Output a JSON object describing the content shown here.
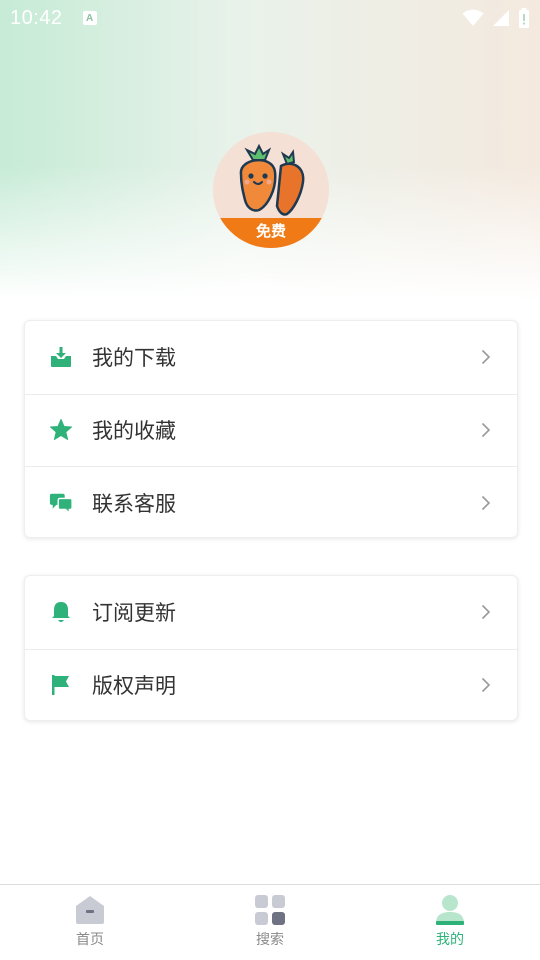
{
  "status_bar": {
    "time": "10:42",
    "notification_icon": "a-icon",
    "icons": [
      "wifi-icon",
      "signal-icon",
      "battery-icon"
    ]
  },
  "avatar": {
    "badge_label": "免费",
    "icon": "carrot-pair"
  },
  "menu_group_1": {
    "items": [
      {
        "label": "我的下载",
        "icon": "download-tray-icon"
      },
      {
        "label": "我的收藏",
        "icon": "star-icon"
      },
      {
        "label": "联系客服",
        "icon": "chat-bubbles-icon"
      }
    ]
  },
  "menu_group_2": {
    "items": [
      {
        "label": "订阅更新",
        "icon": "bell-icon"
      },
      {
        "label": "版权声明",
        "icon": "flag-icon"
      }
    ]
  },
  "bottom_nav": {
    "items": [
      {
        "label": "首页",
        "icon": "home-icon",
        "active": false
      },
      {
        "label": "搜索",
        "icon": "grid-icon",
        "active": false
      },
      {
        "label": "我的",
        "icon": "profile-icon",
        "active": true
      }
    ]
  },
  "colors": {
    "accent": "#2fb27a",
    "badge": "#f07a16",
    "avatar_bg": "#f4e0d4",
    "inactive_nav": "#8a8a8a"
  }
}
